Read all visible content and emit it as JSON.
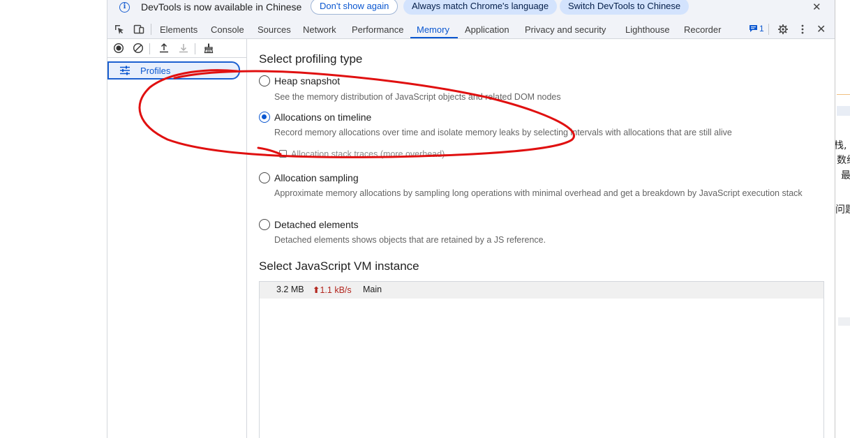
{
  "infobar": {
    "message": "DevTools is now available in Chinese",
    "dont_show": "Don't show again",
    "always_match": "Always match Chrome's language",
    "switch": "Switch DevTools to Chinese",
    "close": "✕"
  },
  "tabs": [
    {
      "label": "Elements"
    },
    {
      "label": "Console"
    },
    {
      "label": "Sources"
    },
    {
      "label": "Network"
    },
    {
      "label": "Performance"
    },
    {
      "label": "Memory",
      "active": true
    },
    {
      "label": "Application"
    },
    {
      "label": "Privacy and security"
    },
    {
      "label": "Lighthouse"
    },
    {
      "label": "Recorder"
    }
  ],
  "toolbar": {
    "issues_count": "1",
    "close": "✕"
  },
  "sidebar": {
    "profiles_label": "Profiles"
  },
  "main": {
    "profiling_title": "Select profiling type",
    "options": [
      {
        "label": "Heap snapshot",
        "desc": "See the memory distribution of JavaScript objects and related DOM nodes",
        "checked": false
      },
      {
        "label": "Allocations on timeline",
        "desc": "Record memory allocations over time and isolate memory leaks by selecting intervals with allocations that are still alive",
        "checked": true
      },
      {
        "label": "Allocation sampling",
        "desc": "Approximate memory allocations by sampling long operations with minimal overhead and get a breakdown by JavaScript execution stack",
        "checked": false
      },
      {
        "label": "Detached elements",
        "desc": "Detached elements shows objects that are retained by a JS reference.",
        "checked": false
      }
    ],
    "stack_traces_label": "Allocation stack traces (more overhead)",
    "vm_title": "Select JavaScript VM instance",
    "vm": {
      "size": "3.2 MB",
      "rate": "1.1 kB/s",
      "name": "Main"
    }
  },
  "right_edge_text": [
    "栈,",
    "数组",
    "最",
    "问题"
  ],
  "colors": {
    "accent": "#0b57d0",
    "annotation": "#e01010",
    "rate_up": "#b3261e"
  }
}
